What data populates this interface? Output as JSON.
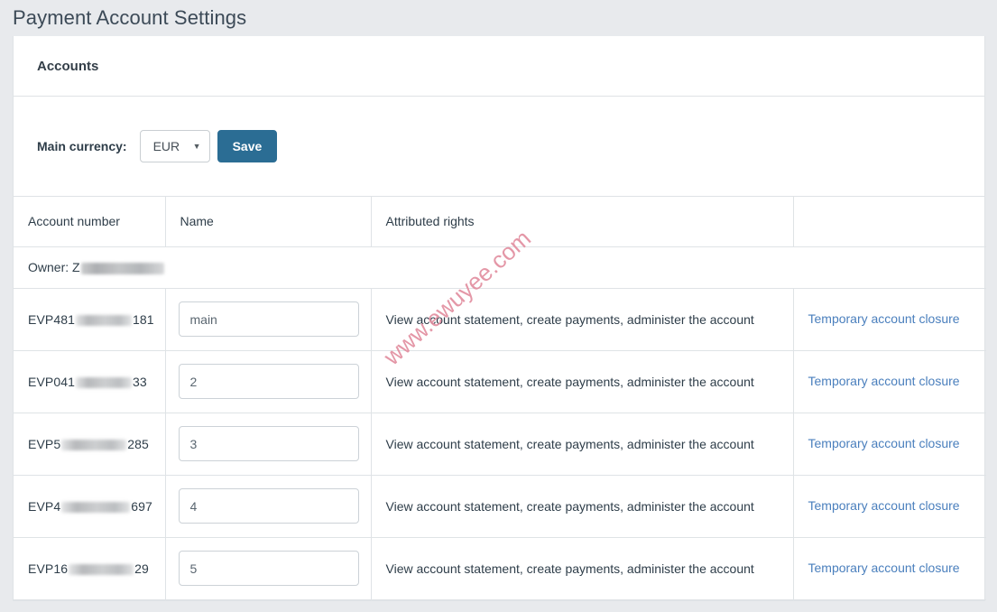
{
  "page": {
    "title": "Payment Account Settings"
  },
  "panel": {
    "header_title": "Accounts"
  },
  "toolbar": {
    "currency_label": "Main currency:",
    "currency_value": "EUR",
    "currency_options": [
      "EUR"
    ],
    "dropdown_arrow": "chevron-down-icon",
    "save_label": "Save"
  },
  "table": {
    "columns": [
      "Account number",
      "Name",
      "Attributed rights",
      ""
    ],
    "owner_row": {
      "label": "Owner:",
      "value_visible": "Z",
      "value_redacted": true
    },
    "rows": [
      {
        "account_prefix": "EVP481",
        "account_suffix": "181",
        "account_redacted": true,
        "name_value": "main",
        "rights": "View account statement, create payments, administer the account",
        "action_label": "Temporary account closure"
      },
      {
        "account_prefix": "EVP041",
        "account_suffix": "33",
        "account_redacted": true,
        "name_value": "2",
        "rights": "View account statement, create payments, administer the account",
        "action_label": "Temporary account closure"
      },
      {
        "account_prefix": "EVP5",
        "account_suffix": "285",
        "account_redacted": true,
        "name_value": "3",
        "rights": "View account statement, create payments, administer the account",
        "action_label": "Temporary account closure"
      },
      {
        "account_prefix": "EVP4",
        "account_suffix": "697",
        "account_redacted": true,
        "name_value": "4",
        "rights": "View account statement, create payments, administer the account",
        "action_label": "Temporary account closure"
      },
      {
        "account_prefix": "EVP16",
        "account_suffix": "29",
        "account_redacted": true,
        "name_value": "5",
        "rights": "View account statement, create payments, administer the account",
        "action_label": "Temporary account closure"
      }
    ]
  },
  "watermark": {
    "text": "www.ewuyee.com",
    "color": "#e28fa0"
  },
  "colors": {
    "page_background": "#e8eaed",
    "panel_background": "#ffffff",
    "border": "#dfe3e6",
    "primary_button": "#2b6d94",
    "link": "#4a7fbd",
    "text": "#2e3d49"
  }
}
